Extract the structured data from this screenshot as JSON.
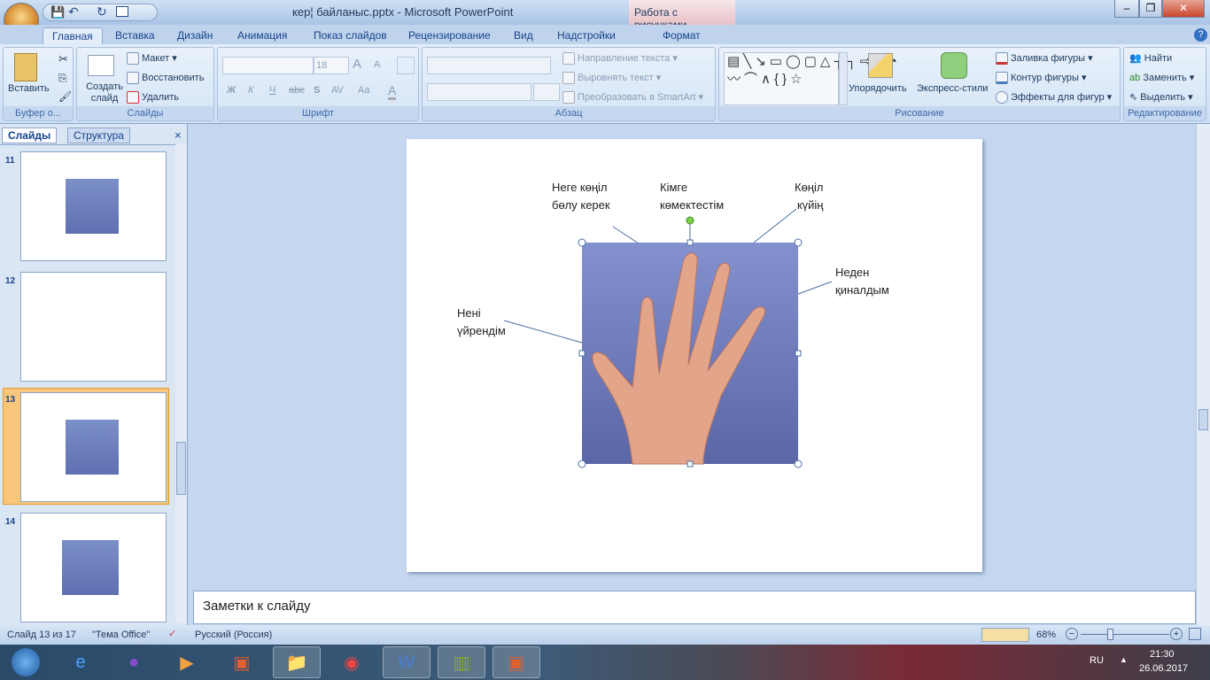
{
  "window": {
    "title": "кер¦ байланыс.pptx - Microsoft PowerPoint",
    "context_tab": "Работа с рисунками",
    "min": "–",
    "restore": "❐",
    "close": "✕"
  },
  "tabs": [
    "Главная",
    "Вставка",
    "Дизайн",
    "Анимация",
    "Показ слайдов",
    "Рецензирование",
    "Вид",
    "Надстройки",
    "Формат"
  ],
  "ribbon": {
    "clipboard": {
      "label": "Буфер о...",
      "paste": "Вставить"
    },
    "slides": {
      "label": "Слайды",
      "new": "Создать слайд",
      "layout": "Макет",
      "reset": "Восстановить",
      "delete": "Удалить"
    },
    "font": {
      "label": "Шрифт",
      "size": "18",
      "bold": "Ж",
      "italic": "К",
      "underline": "Ч",
      "strike": "abc",
      "shadow": "S",
      "spacing": "AV",
      "case": "Aa",
      "color": "A",
      "grow": "A",
      "shrink": "A"
    },
    "paragraph": {
      "label": "Абзац",
      "direction": "Направление текста",
      "align": "Выровнять текст",
      "smartart": "Преобразовать в SmartArt"
    },
    "drawing": {
      "label": "Рисование",
      "arrange": "Упорядочить",
      "styles": "Экспресс-стили",
      "fill": "Заливка фигуры",
      "outline": "Контур фигуры",
      "effects": "Эффекты для фигур"
    },
    "editing": {
      "label": "Редактирование",
      "find": "Найти",
      "replace": "Заменить",
      "select": "Выделить"
    }
  },
  "panel": {
    "tab_slides": "Слайды",
    "tab_outline": "Структура",
    "close": "×",
    "thumbs": [
      {
        "num": "11"
      },
      {
        "num": "12"
      },
      {
        "num": "13"
      },
      {
        "num": "14"
      }
    ]
  },
  "slide": {
    "labels": {
      "nege": "Неге көңіл\nбөлу керек",
      "kimge": "Кімге\nкөмектестім",
      "konil": "Көңіл\nкүйің",
      "neden": "Неден\nқиналдым",
      "neni": "Нені\nүйрендім"
    }
  },
  "notes": "Заметки к слайду",
  "status": {
    "slide": "Слайд 13 из 17",
    "theme": "\"Тема Office\"",
    "lang": "Русский (Россия)",
    "zoom": "68%",
    "zoom_fraction": 0.3
  },
  "tray": {
    "lang": "RU",
    "time": "21:30",
    "date": "26.06.2017"
  }
}
